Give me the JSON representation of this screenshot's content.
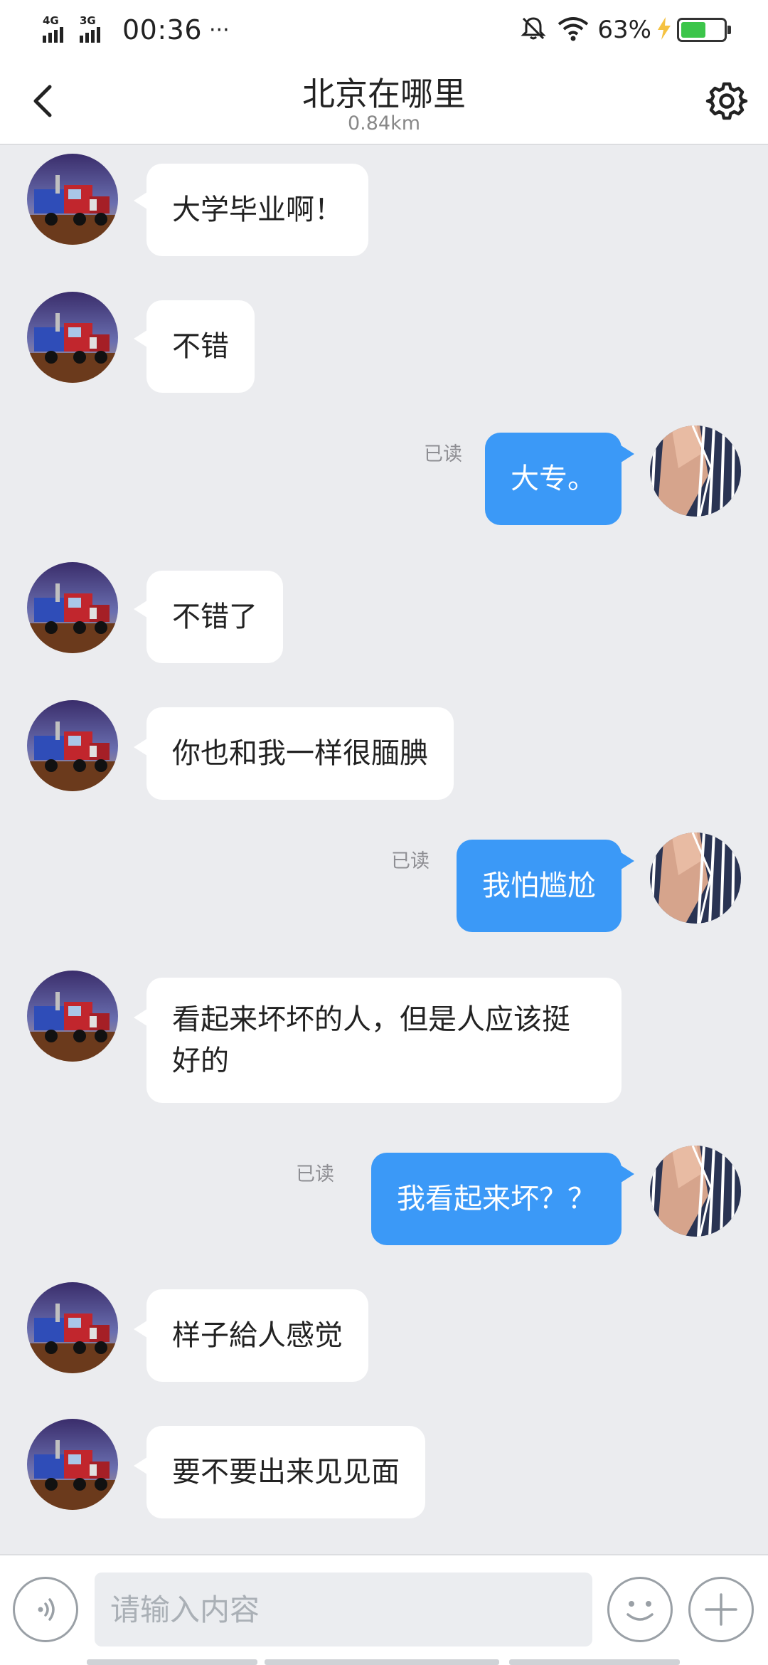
{
  "status_bar": {
    "net1": "4G",
    "net2": "3G",
    "time": "00:36",
    "more": "···",
    "battery_text": "63%",
    "battery_level": 0.63,
    "battery_color": "#3cc54a",
    "icons": [
      "signal-icon",
      "mute-bell-icon",
      "wifi-icon",
      "charging-bolt-icon",
      "battery-icon"
    ]
  },
  "header": {
    "title": "北京在哪里",
    "subtitle": "0.84km",
    "back_icon": "chevron-left-icon",
    "settings_icon": "gear-icon"
  },
  "messages": [
    {
      "side": "left",
      "text": "大学毕业啊！"
    },
    {
      "side": "left",
      "text": "不错"
    },
    {
      "side": "right",
      "text": "大专。",
      "status": "已读"
    },
    {
      "side": "left",
      "text": "不错了"
    },
    {
      "side": "left",
      "text": "你也和我一样很腼腆"
    },
    {
      "side": "right",
      "text": "我怕尴尬",
      "status": "已读"
    },
    {
      "side": "left",
      "text": "看起来坏坏的人，但是人应该挺好的"
    },
    {
      "side": "right",
      "text": "我看起来坏？？",
      "status": "已读"
    },
    {
      "side": "left",
      "text": "样子給人感觉"
    },
    {
      "side": "left",
      "text": "要不要出来见见面"
    }
  ],
  "input_bar": {
    "placeholder": "请输入内容",
    "icons": [
      "voice-icon",
      "emoji-icon",
      "plus-icon"
    ]
  },
  "colors": {
    "accent": "#3b99f7",
    "background": "#ebecef",
    "bubble_incoming": "#ffffff"
  }
}
